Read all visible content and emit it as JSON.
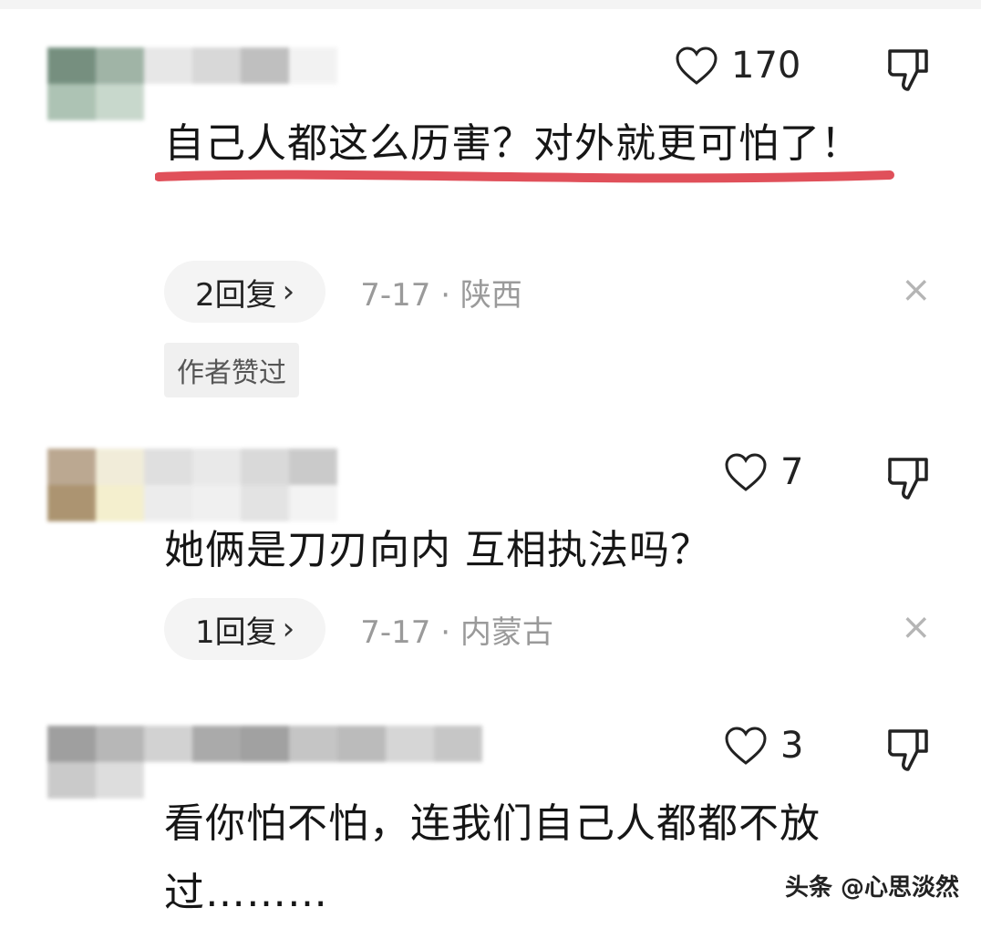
{
  "comments": [
    {
      "likes": "170",
      "text": "自己人都这么历害？对外就更可怕了！",
      "reply_count": "2回复",
      "chevron": "›",
      "time_location": "7-17 · 陕西",
      "badge": "作者赞过",
      "close": "×",
      "icons": [
        "heart-icon",
        "thumbs-down-icon",
        "close-icon",
        "chevron-right-icon"
      ],
      "underline_color": "#e0505a"
    },
    {
      "likes": "7",
      "text": "她俩是刀刃向内 互相执法吗？",
      "reply_count": "1回复",
      "chevron": "›",
      "time_location": "7-17 · 内蒙古",
      "close": "×"
    },
    {
      "likes": "3",
      "text": "看你怕不怕，连我们自己人都都不放过………"
    }
  ],
  "watermark": "头条 @心思淡然"
}
